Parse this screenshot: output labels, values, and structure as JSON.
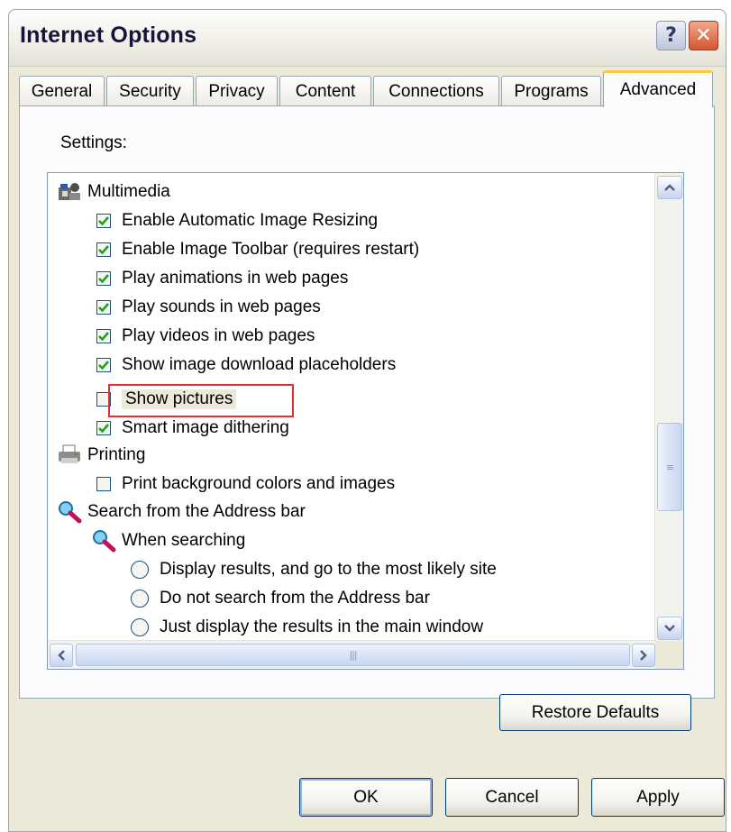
{
  "window": {
    "title": "Internet Options"
  },
  "tabs": [
    {
      "label": "General"
    },
    {
      "label": "Security"
    },
    {
      "label": "Privacy"
    },
    {
      "label": "Content"
    },
    {
      "label": "Connections"
    },
    {
      "label": "Programs"
    },
    {
      "label": "Advanced"
    }
  ],
  "active_tab": "Advanced",
  "settings_label": "Settings:",
  "items": {
    "multimedia": {
      "label": "Multimedia",
      "icon": "multimedia-icon"
    },
    "auto_resize": {
      "label": "Enable Automatic Image Resizing",
      "checked": true
    },
    "image_toolbar": {
      "label": "Enable Image Toolbar (requires restart)",
      "checked": true
    },
    "animations": {
      "label": "Play animations in web pages",
      "checked": true
    },
    "sounds": {
      "label": "Play sounds in web pages",
      "checked": true
    },
    "videos": {
      "label": "Play videos in web pages",
      "checked": true
    },
    "placeholders": {
      "label": "Show image download placeholders",
      "checked": true
    },
    "show_pictures": {
      "label": "Show pictures",
      "checked": false
    },
    "dithering": {
      "label": "Smart image dithering",
      "checked": true
    },
    "printing": {
      "label": "Printing",
      "icon": "printer-icon"
    },
    "print_bg": {
      "label": "Print background colors and images",
      "checked": false
    },
    "search": {
      "label": "Search from the Address bar",
      "icon": "magnifier-icon"
    },
    "when_searching": {
      "label": "When searching",
      "icon": "magnifier-icon"
    },
    "opt_display": {
      "label": "Display results, and go to the most likely site",
      "selected": false
    },
    "opt_none": {
      "label": "Do not search from the Address bar",
      "selected": false
    },
    "opt_just": {
      "label": "Just display the results in the main window",
      "selected": false
    }
  },
  "buttons": {
    "restore": "Restore Defaults",
    "ok": "OK",
    "cancel": "Cancel",
    "apply": "Apply"
  },
  "colors": {
    "highlight_box": "#e03030",
    "check": "#21a121",
    "tab_accent": "#ffc83c"
  }
}
